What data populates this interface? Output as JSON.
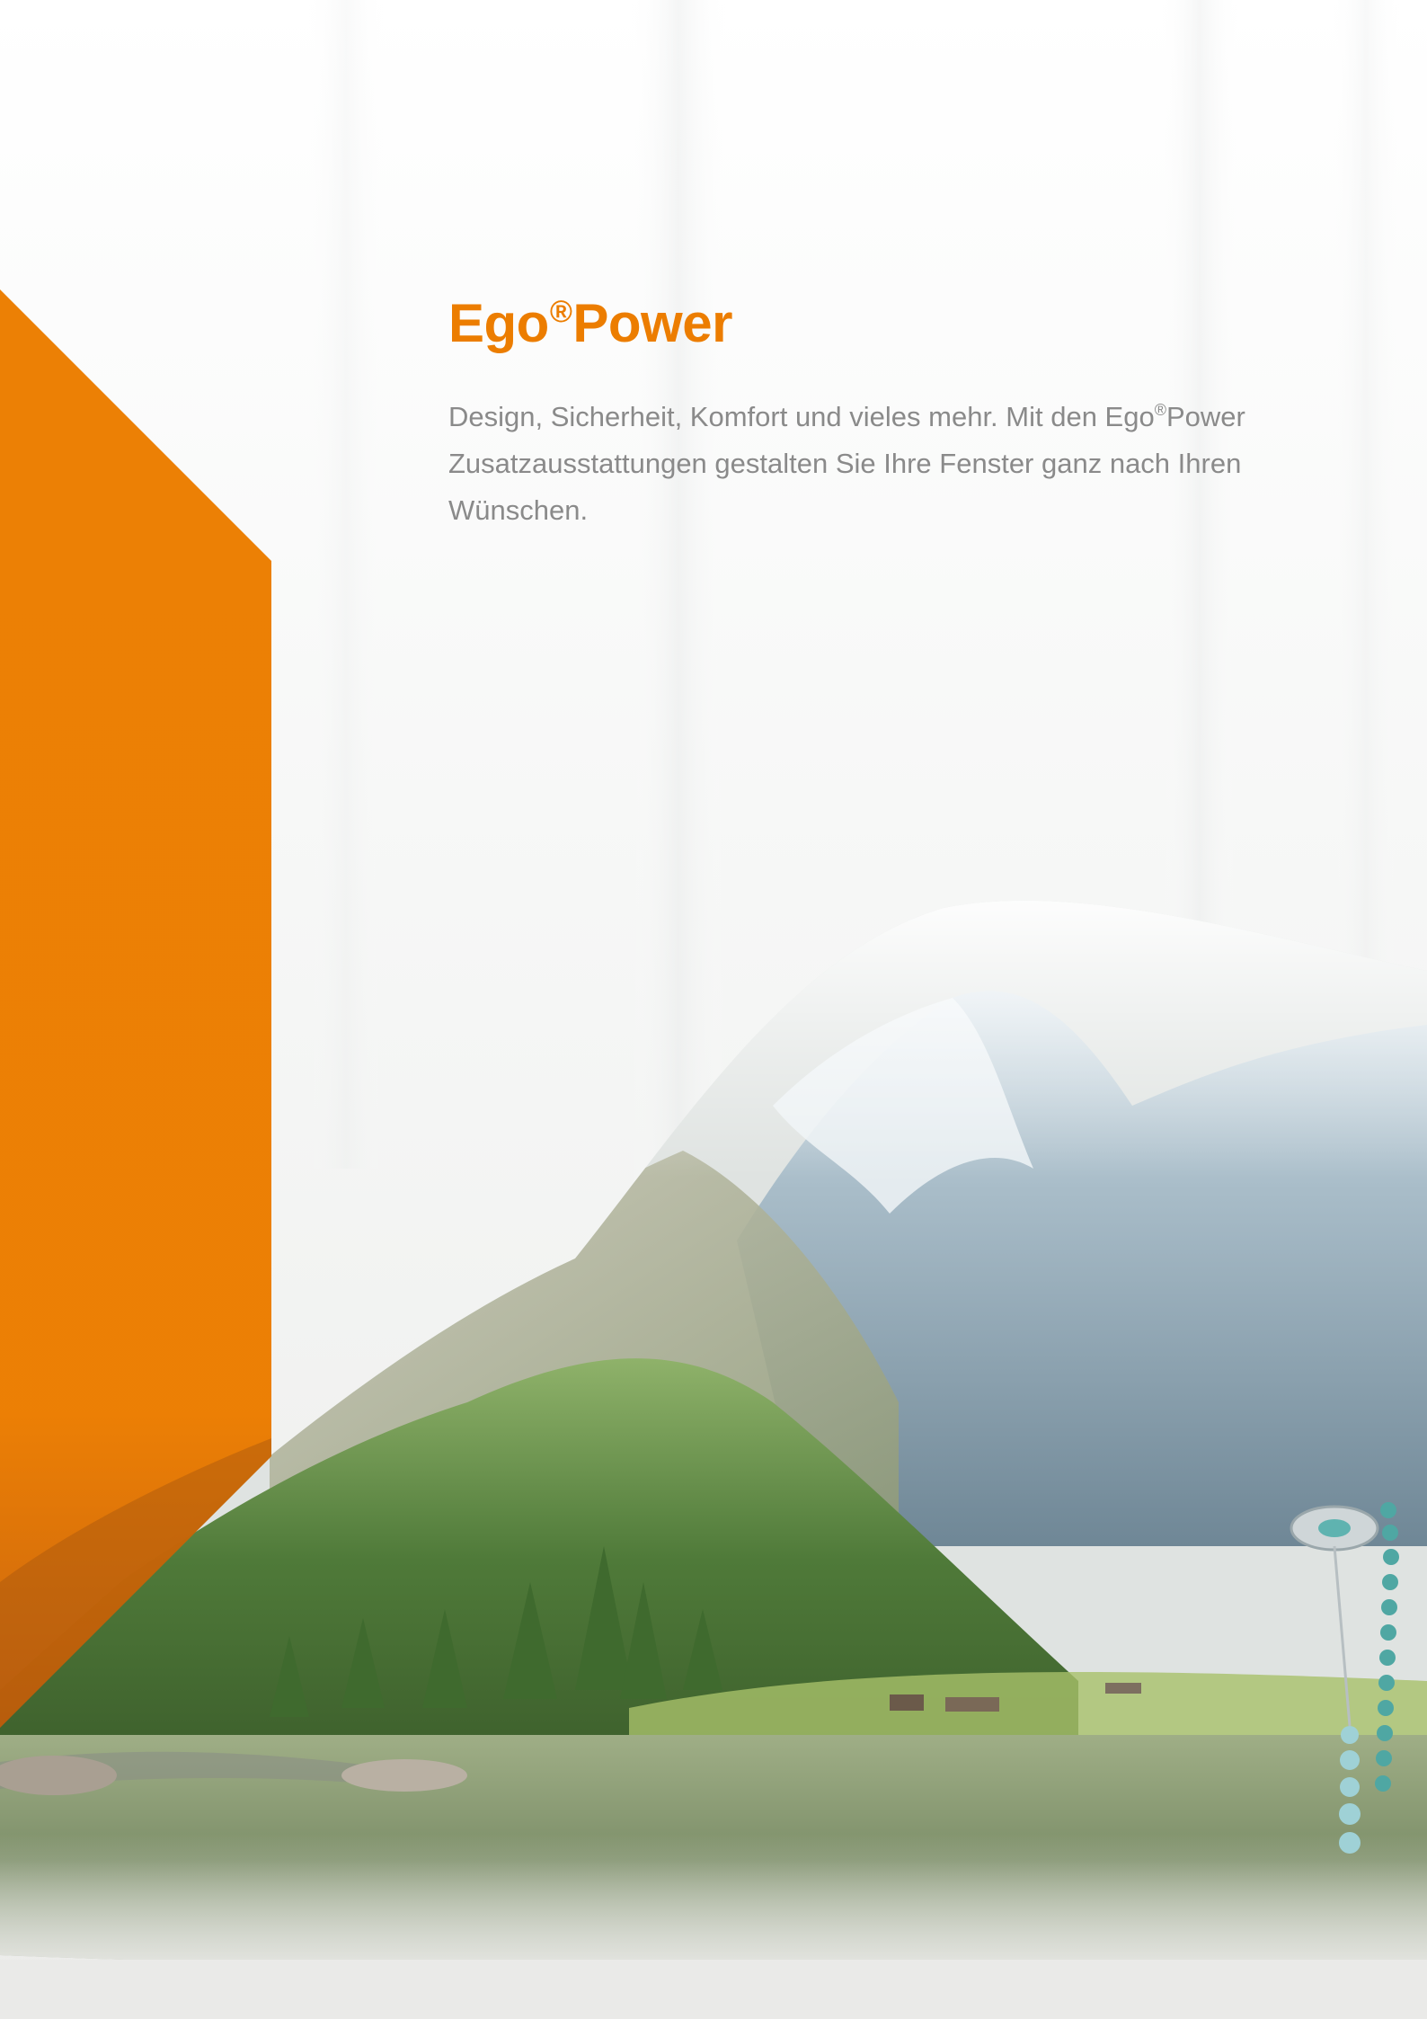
{
  "page": {
    "title_main": "Ego",
    "title_mark": "®",
    "title_suffix": "Power",
    "intro_part1": "Design, Sicherheit, Komfort und vieles mehr. Mit den Ego",
    "intro_mark": "®",
    "intro_part2": "Power Zusatzausstattungen gestalten Sie Ihre Fenster ganz nach Ihren Wünschen."
  },
  "colors": {
    "accent_orange": "#ec7d00",
    "text_gray": "#8a8a8a",
    "background": "#f7f7f6"
  }
}
